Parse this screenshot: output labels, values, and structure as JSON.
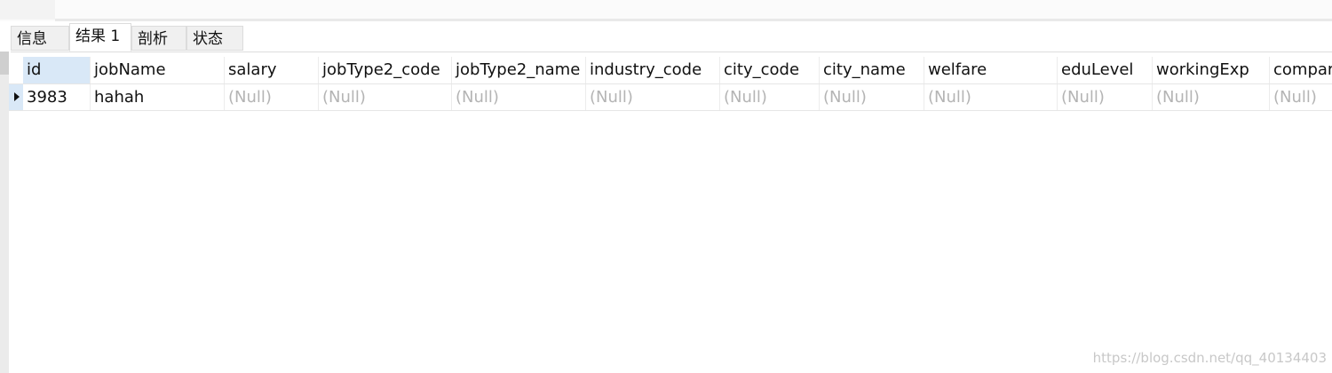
{
  "tabs": [
    {
      "label": "信息"
    },
    {
      "label": "结果 1"
    },
    {
      "label": "剖析"
    },
    {
      "label": "状态"
    }
  ],
  "active_tab": "结果 1",
  "columns": [
    "id",
    "jobName",
    "salary",
    "jobType2_code",
    "jobType2_name",
    "industry_code",
    "city_code",
    "city_name",
    "welfare",
    "eduLevel",
    "workingExp",
    "compar"
  ],
  "rows": [
    [
      "3983",
      "hahah",
      "(Null)",
      "(Null)",
      "(Null)",
      "(Null)",
      "(Null)",
      "(Null)",
      "(Null)",
      "(Null)",
      "(Null)",
      "(Null)"
    ]
  ],
  "watermark": "https://blog.csdn.net/qq_40134403"
}
